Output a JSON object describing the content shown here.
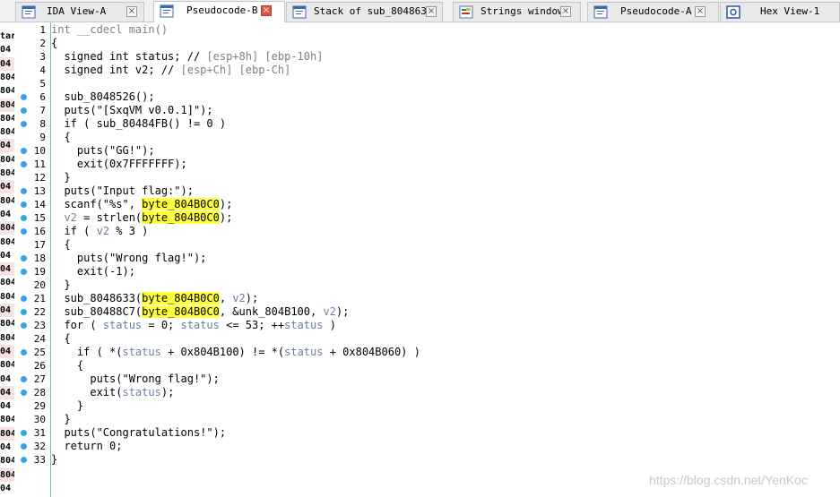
{
  "tabs": [
    {
      "label": "IDA View-A",
      "icon": "ida-view-icon",
      "active": false
    },
    {
      "label": "Pseudocode-B",
      "icon": "pseudocode-icon",
      "active": true
    },
    {
      "label": "Stack of sub_8048633",
      "icon": "stack-icon",
      "active": false
    },
    {
      "label": "Strings window",
      "icon": "strings-icon",
      "active": false
    },
    {
      "label": "Pseudocode-A",
      "icon": "pseudocode-icon",
      "active": false
    },
    {
      "label": "Hex View-1",
      "icon": "hex-view-icon",
      "active": false
    }
  ],
  "tab_close_glyph": "×",
  "left_strip": [
    "tar",
    "04",
    "04",
    "804",
    "804",
    "804",
    "804",
    "804",
    "04",
    "804",
    "804",
    "04",
    "804",
    "04",
    "804",
    "804",
    "04",
    "04",
    "804",
    "804",
    "04",
    "804",
    "804",
    "04",
    "804",
    "04",
    "04",
    "04",
    "804",
    "804",
    "04",
    "804",
    "804",
    "04",
    "804"
  ],
  "breakpoint_lines": [
    6,
    7,
    8,
    10,
    11,
    13,
    14,
    15,
    16,
    18,
    19,
    21,
    22,
    23,
    25,
    27,
    28,
    31,
    32,
    33
  ],
  "code": [
    {
      "n": "1",
      "s": [
        [
          "int __cdecl main()",
          "gray"
        ]
      ]
    },
    {
      "n": "2",
      "s": [
        [
          "{",
          ""
        ]
      ]
    },
    {
      "n": "3",
      "s": [
        [
          "  signed int status; // ",
          ""
        ],
        [
          "[esp+8h] [ebp-10h]",
          "gray"
        ]
      ]
    },
    {
      "n": "4",
      "s": [
        [
          "  signed int v2; // ",
          ""
        ],
        [
          "[esp+Ch] [ebp-Ch]",
          "gray"
        ]
      ]
    },
    {
      "n": "5",
      "s": []
    },
    {
      "n": "6",
      "s": [
        [
          "  sub_8048526();",
          ""
        ]
      ]
    },
    {
      "n": "7",
      "s": [
        [
          "  puts(\"[SxqVM v0.0.1]\");",
          ""
        ]
      ]
    },
    {
      "n": "8",
      "s": [
        [
          "  if ( sub_80484FB() != 0 )",
          ""
        ]
      ]
    },
    {
      "n": "9",
      "s": [
        [
          "  {",
          ""
        ]
      ]
    },
    {
      "n": "10",
      "s": [
        [
          "    puts(\"GG!\");",
          ""
        ]
      ]
    },
    {
      "n": "11",
      "s": [
        [
          "    exit(0x7FFFFFFF);",
          ""
        ]
      ]
    },
    {
      "n": "12",
      "s": [
        [
          "  }",
          ""
        ]
      ]
    },
    {
      "n": "13",
      "s": [
        [
          "  puts(\"Input flag:\");",
          ""
        ]
      ]
    },
    {
      "n": "14",
      "s": [
        [
          "  scanf(\"%s\", ",
          ""
        ],
        [
          "byte_804B0C0",
          "hl"
        ],
        [
          ");",
          ""
        ]
      ]
    },
    {
      "n": "15",
      "s": [
        [
          "  ",
          ""
        ],
        [
          "v2",
          "var"
        ],
        [
          " = strlen(",
          ""
        ],
        [
          "byte_804B0C0",
          "hl"
        ],
        [
          ");",
          ""
        ]
      ]
    },
    {
      "n": "16",
      "s": [
        [
          "  if ( ",
          ""
        ],
        [
          "v2",
          "var"
        ],
        [
          " % 3 )",
          ""
        ]
      ]
    },
    {
      "n": "17",
      "s": [
        [
          "  {",
          ""
        ]
      ]
    },
    {
      "n": "18",
      "s": [
        [
          "    puts(\"Wrong flag!\");",
          ""
        ]
      ]
    },
    {
      "n": "19",
      "s": [
        [
          "    exit(-1);",
          ""
        ]
      ]
    },
    {
      "n": "20",
      "s": [
        [
          "  }",
          ""
        ]
      ]
    },
    {
      "n": "21",
      "s": [
        [
          "  sub_8048633(",
          ""
        ],
        [
          "byte_804B0C0",
          "hl"
        ],
        [
          ", ",
          ""
        ],
        [
          "v2",
          "var"
        ],
        [
          ");",
          ""
        ]
      ]
    },
    {
      "n": "22",
      "s": [
        [
          "  sub_80488C7(",
          ""
        ],
        [
          "byte_804B0C0",
          "hl"
        ],
        [
          ", &unk_804B100, ",
          ""
        ],
        [
          "v2",
          "var"
        ],
        [
          ");",
          ""
        ]
      ]
    },
    {
      "n": "23",
      "s": [
        [
          "  for ( ",
          ""
        ],
        [
          "status",
          "var"
        ],
        [
          " = 0; ",
          ""
        ],
        [
          "status",
          "var"
        ],
        [
          " <= 53; ++",
          ""
        ],
        [
          "status",
          "var"
        ],
        [
          " )",
          ""
        ]
      ]
    },
    {
      "n": "24",
      "s": [
        [
          "  {",
          ""
        ]
      ]
    },
    {
      "n": "25",
      "s": [
        [
          "    if ( *(",
          ""
        ],
        [
          "status",
          "var"
        ],
        [
          " + 0x804B100) != *(",
          ""
        ],
        [
          "status",
          "var"
        ],
        [
          " + 0x804B060) )",
          ""
        ]
      ]
    },
    {
      "n": "26",
      "s": [
        [
          "    {",
          ""
        ]
      ]
    },
    {
      "n": "27",
      "s": [
        [
          "      puts(\"Wrong flag!\");",
          ""
        ]
      ]
    },
    {
      "n": "28",
      "s": [
        [
          "      exit(",
          ""
        ],
        [
          "status",
          "var"
        ],
        [
          ");",
          ""
        ]
      ]
    },
    {
      "n": "29",
      "s": [
        [
          "    }",
          ""
        ]
      ]
    },
    {
      "n": "30",
      "s": [
        [
          "  }",
          ""
        ]
      ]
    },
    {
      "n": "31",
      "s": [
        [
          "  puts(\"Congratulations!\");",
          ""
        ]
      ]
    },
    {
      "n": "32",
      "s": [
        [
          "  return 0;",
          ""
        ]
      ]
    },
    {
      "n": "33",
      "s": [
        [
          "}",
          ""
        ]
      ]
    }
  ],
  "watermark": "https://blog.csdn.net/YenKoc",
  "colors": {
    "highlight": "#ffff3a",
    "breakpoint": "#39a2e6",
    "variable": "#6c7fa8",
    "comment": "#808080",
    "active_close": "#e0533d"
  }
}
